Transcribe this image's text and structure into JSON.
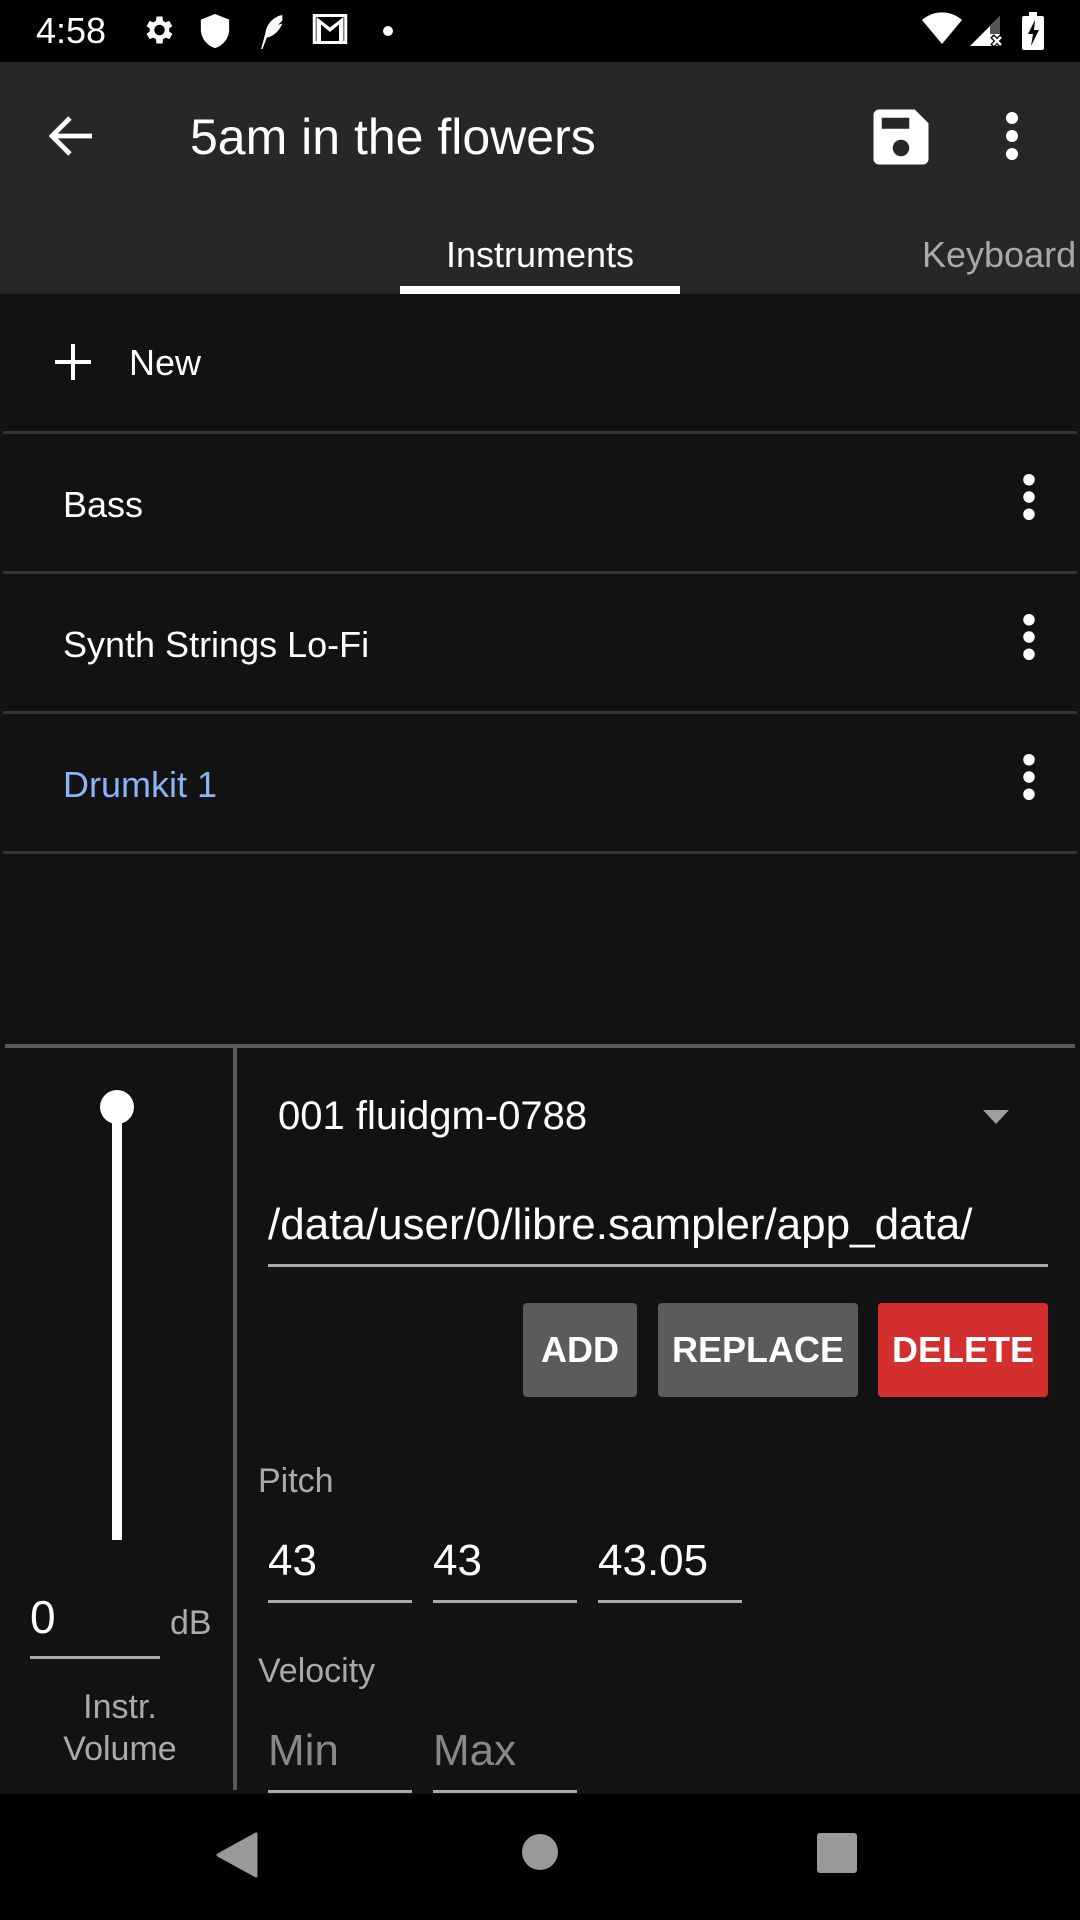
{
  "status_bar": {
    "time": "4:58",
    "left_icons": [
      "gear-icon",
      "shield-icon",
      "feather-icon",
      "gmail-icon",
      "dot-icon"
    ],
    "right_icons": [
      "wifi-icon",
      "cell-signal-no-data-icon",
      "battery-charging-icon"
    ]
  },
  "app_bar": {
    "title": "5am in the flowers",
    "back_icon": "arrow-left-icon",
    "save_icon": "floppy-disk-icon",
    "more_icon": "more-vertical-icon"
  },
  "tabs": [
    {
      "label": "Instruments",
      "active": true
    },
    {
      "label": "Keyboard",
      "active": false
    }
  ],
  "instruments": {
    "new_label": "New",
    "items": [
      {
        "name": "Bass",
        "selected": false
      },
      {
        "name": "Synth Strings Lo-Fi",
        "selected": false
      },
      {
        "name": "Drumkit 1",
        "selected": true
      }
    ]
  },
  "colors": {
    "selected_text": "#8ab4f8",
    "delete_button": "#d32f2f",
    "neutral_button": "#5b5b5b"
  },
  "volume": {
    "value": "0",
    "unit": "dB",
    "label": "Instr. Volume",
    "slider_level_fraction": 1.0
  },
  "sample": {
    "selected": "001 fluidgm-0788",
    "path": "/data/user/0/libre.sampler/app_data/",
    "buttons": {
      "add": "ADD",
      "replace": "REPLACE",
      "delete": "DELETE"
    }
  },
  "pitch": {
    "label": "Pitch",
    "values": [
      "43",
      "43",
      "43.05"
    ]
  },
  "velocity": {
    "label": "Velocity",
    "min_placeholder": "Min",
    "max_placeholder": "Max"
  }
}
